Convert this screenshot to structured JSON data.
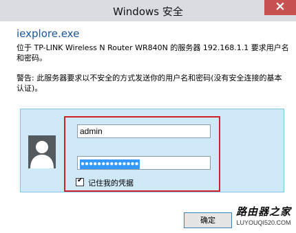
{
  "window": {
    "title": "Windows 安全"
  },
  "dialog": {
    "app_name": "iexplore.exe",
    "message": "位于 TP-LINK Wireless N Router WR840N 的服务器 192.168.1.1 要求用户名和密码。",
    "warning": "警告: 此服务器要求以不安全的方式发送你的用户名和密码(没有安全连接的基本认证)。"
  },
  "credentials": {
    "username": "admin",
    "password_mask": "●●●●●●●●●●●●●●",
    "remember_label": "记住我的凭据",
    "remember_checked": true
  },
  "buttons": {
    "ok_label": "确定"
  },
  "watermark": {
    "main": "路由器之家",
    "sub": "LUYOUQI520.COM"
  },
  "colors": {
    "titlebar": "#d9dde1",
    "close": "#c75050",
    "panel": "#cfe9f8",
    "highlight": "#d61f22",
    "app_name": "#1a55a5"
  }
}
